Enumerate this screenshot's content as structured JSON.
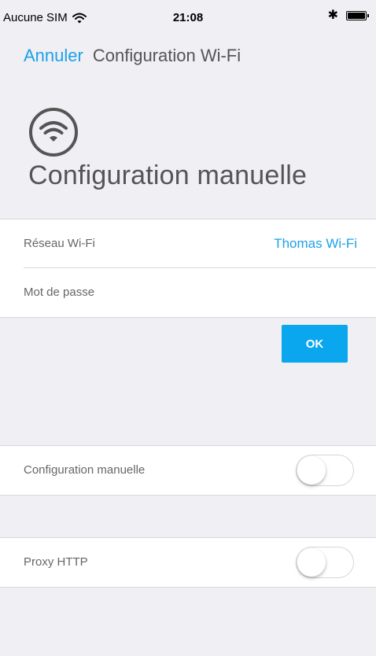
{
  "status_bar": {
    "carrier": "Aucune SIM",
    "time": "21:08",
    "wifi_icon": "wifi-icon",
    "bluetooth_icon": "bluetooth-icon",
    "battery_icon": "battery-icon"
  },
  "nav": {
    "cancel_label": "Annuler",
    "title": "Configuration Wi-Fi"
  },
  "header": {
    "icon": "wifi-icon",
    "title": "Configuration manuelle"
  },
  "form": {
    "network_label": "Réseau Wi-Fi",
    "network_value": "Thomas Wi-Fi",
    "password_label": "Mot de passe",
    "ok_label": "OK"
  },
  "settings": {
    "manual_config_label": "Configuration manuelle",
    "manual_config_on": false,
    "proxy_label": "Proxy HTTP",
    "proxy_on": false
  },
  "colors": {
    "accent": "#1da1e8",
    "ok_button": "#0aa7ef",
    "background": "#efeff4"
  }
}
